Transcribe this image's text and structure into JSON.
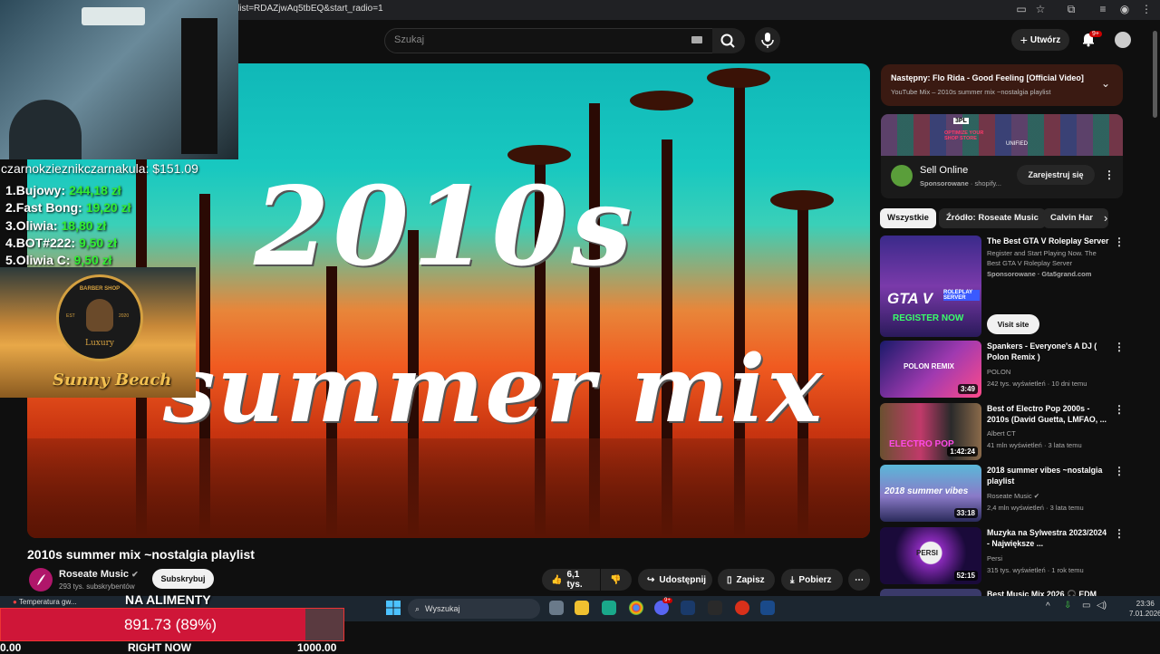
{
  "browser": {
    "url": "list=RDAZjwAq5tbEQ&start_radio=1"
  },
  "header": {
    "search_placeholder": "Szukaj",
    "create_label": "Utwórz",
    "notification_count": "9+"
  },
  "player": {
    "overlay_line1": "2010s",
    "overlay_line2": "summer mix"
  },
  "stream_overlay": {
    "donation_line": "czarnokzieznikczarnakula: $151.09",
    "leaderboard": [
      {
        "rank": "1.",
        "name": "Bujowy:",
        "amount": "244,18 zł"
      },
      {
        "rank": "2.",
        "name": "Fast Bong:",
        "amount": "19,20 zł"
      },
      {
        "rank": "3.",
        "name": "Oliwia:",
        "amount": "18,80 zł"
      },
      {
        "rank": "4.",
        "name": "BOT#222:",
        "amount": "9,50 zł"
      },
      {
        "rank": "5.",
        "name": "Oliwia C:",
        "amount": "9,50 zł"
      }
    ],
    "beach_card": {
      "logo_top": "BARBER SHOP",
      "logo_mid": "Luxury",
      "logo_est": "EST",
      "logo_year": "2020",
      "brand": "Sunny Beach"
    },
    "goal": {
      "label": "NA ALIMENTY",
      "value_text": "891.73 (89%)",
      "progress": 0.89,
      "min_label": "0.00",
      "now_label": "RIGHT NOW",
      "max_label": "1000.00"
    }
  },
  "video": {
    "title": "2010s summer mix ~nostalgia playlist",
    "channel": "Roseate Music",
    "subscribers": "293 tys. subskrybentów",
    "subscribe_label": "Subskrybuj",
    "likes": "6,1 tys.",
    "share_label": "Udostępnij",
    "save_label": "Zapisz",
    "download_label": "Pobierz"
  },
  "sidebar": {
    "up_next": {
      "title": "Następny: Flo Rida - Good Feeling [Official Video]",
      "subtitle": "YouTube Mix – 2010s summer mix ~nostalgia playlist"
    },
    "ad": {
      "title": "Sell Online",
      "sponsor": "Sponsorowane",
      "domain": "· shopify...",
      "cta": "Zarejestruj się",
      "banner_text1": "OPTIMIZE YOUR SHOP STORE",
      "banner_text2": "UNIFIED",
      "banner_text3": "3PL"
    },
    "chips": [
      "Wszystkie",
      "Źródło: Roseate Music",
      "Calvin Har"
    ],
    "recommendations": [
      {
        "title": "The Best GTA V Roleplay Server",
        "line2": "Register and Start Playing Now. The Best GTA V Roleplay Server",
        "meta": "Sponsorowane · Gta5grand.com",
        "cta": "Visit site",
        "thumb_line1": "GTA V",
        "thumb_line2": "ROLEPLAY SERVER",
        "thumb_line3": "REGISTER NOW"
      },
      {
        "title": "Spankers - Everyone's A DJ ( Polon Remix )",
        "channel": "POLON",
        "meta": "242 tys. wyświetleń · 10 dni temu",
        "duration": "3:49",
        "thumb_text": "POLON REMIX"
      },
      {
        "title": "Best of Electro Pop 2000s - 2010s (David Guetta, LMFAO, ...",
        "channel": "Albert CT",
        "meta": "41 mln wyświetleń · 3 lata temu",
        "duration": "1:42:24",
        "thumb_text": "ELECTRO POP"
      },
      {
        "title": "2018 summer vibes ~nostalgia playlist",
        "channel": "Roseate Music",
        "meta": "2,4 mln wyświetleń · 3 lata temu",
        "duration": "33:18",
        "thumb_text": "2018 summer vibes"
      },
      {
        "title": "Muzyka na Sylwestra 2023/2024 - Największe ...",
        "channel": "Persi",
        "meta": "315 tys. wyświetleń · 1 rok temu",
        "duration": "52:15",
        "thumb_text": "PERSI"
      },
      {
        "title": "Best Music Mix 2026 🎧 EDM"
      }
    ]
  },
  "taskbar": {
    "weather": "Temperatura gw...",
    "search_label": "Wyszukaj",
    "time": "23:36",
    "date": "7.01.2026",
    "discord_badge": "9+"
  },
  "colors": {
    "accent_red": "#cc0000",
    "goal_fill": "#cf1638",
    "leaderboard_amount": "#33ee33"
  }
}
